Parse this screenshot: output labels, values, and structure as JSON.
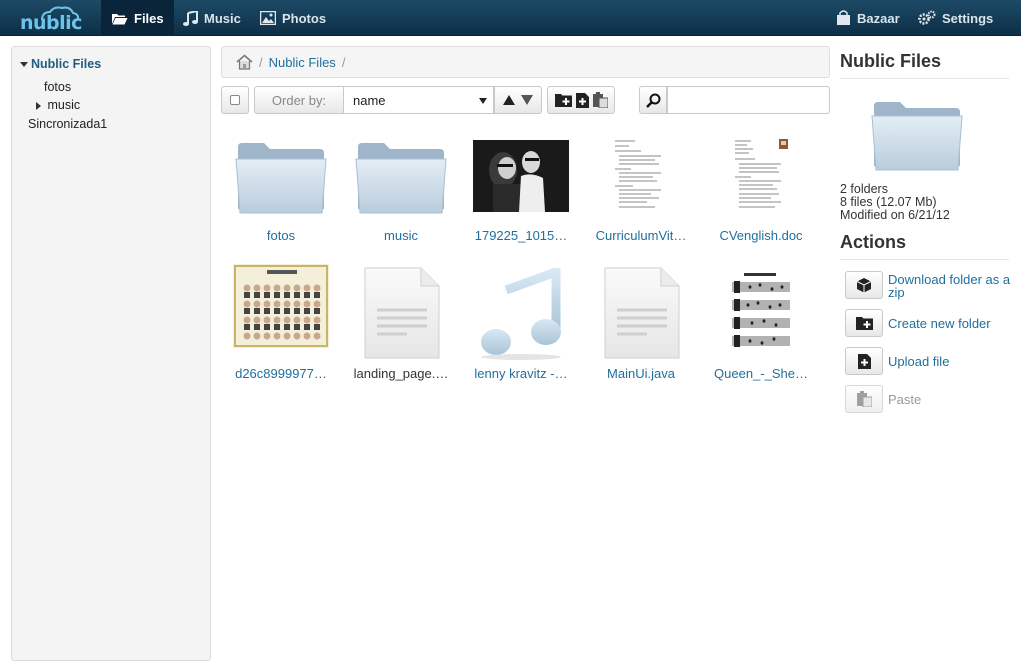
{
  "app": {
    "logo": "nublic"
  },
  "nav": {
    "files": "Files",
    "music": "Music",
    "photos": "Photos",
    "bazaar": "Bazaar",
    "settings": "Settings"
  },
  "tree": {
    "root": "Nublic Files",
    "children": [
      "fotos",
      "music"
    ],
    "other": "Sincronizada1"
  },
  "breadcrumb": {
    "separator": "/",
    "current": "Nublic Files"
  },
  "toolbar": {
    "order_by_label": "Order by:",
    "order_by_value": "name",
    "search_placeholder": ""
  },
  "items": [
    {
      "label": "fotos",
      "type": "folder"
    },
    {
      "label": "music",
      "type": "folder"
    },
    {
      "label": "179225_1015…",
      "type": "photo"
    },
    {
      "label": "CurriculumVit…",
      "type": "document"
    },
    {
      "label": "CVenglish.doc",
      "type": "document"
    },
    {
      "label": "d26c8999977…",
      "type": "image"
    },
    {
      "label": "landing_page.…",
      "type": "text"
    },
    {
      "label": "lenny kravitz -…",
      "type": "audio"
    },
    {
      "label": "MainUi.java",
      "type": "text"
    },
    {
      "label": "Queen_-_She…",
      "type": "sheet"
    }
  ],
  "details": {
    "title": "Nublic Files",
    "folders": "2 folders",
    "files": "8 files (12.07 Mb)",
    "modified": "Modified on 6/21/12"
  },
  "actions": {
    "title": "Actions",
    "download_line1": "Download folder as a",
    "download_line2": "zip",
    "new_folder": "Create new folder",
    "upload": "Upload file",
    "paste": "Paste"
  }
}
